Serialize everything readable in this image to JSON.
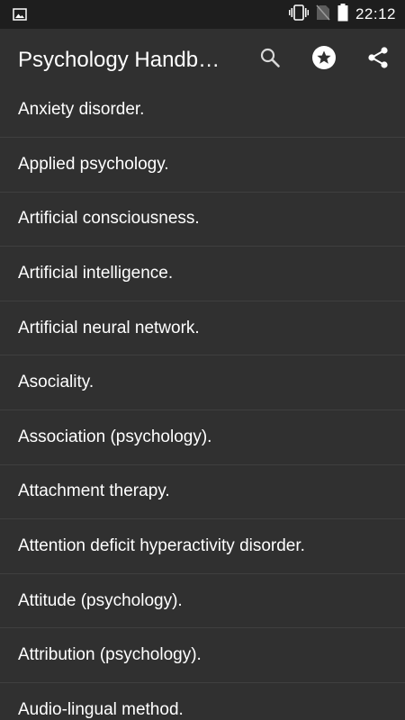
{
  "status_bar": {
    "time": "22:12",
    "icons": [
      "gallery-icon",
      "vibrate-icon",
      "no-sim-icon",
      "battery-icon"
    ]
  },
  "app_bar": {
    "title": "Psychology Handb…",
    "actions": [
      "search-icon",
      "star-icon",
      "share-icon"
    ]
  },
  "list": {
    "items": [
      {
        "label": "Anxiety disorder."
      },
      {
        "label": "Applied psychology."
      },
      {
        "label": "Artificial consciousness."
      },
      {
        "label": "Artificial intelligence."
      },
      {
        "label": "Artificial neural network."
      },
      {
        "label": "Asociality."
      },
      {
        "label": "Association (psychology)."
      },
      {
        "label": "Attachment therapy."
      },
      {
        "label": "Attention deficit hyperactivity disorder."
      },
      {
        "label": "Attitude (psychology)."
      },
      {
        "label": "Attribution (psychology)."
      },
      {
        "label": "Audio-lingual method."
      }
    ]
  },
  "colors": {
    "background": "#303030",
    "status_bar": "#1e1e1e",
    "divider": "#3f3f3f",
    "text": "#ffffff"
  }
}
